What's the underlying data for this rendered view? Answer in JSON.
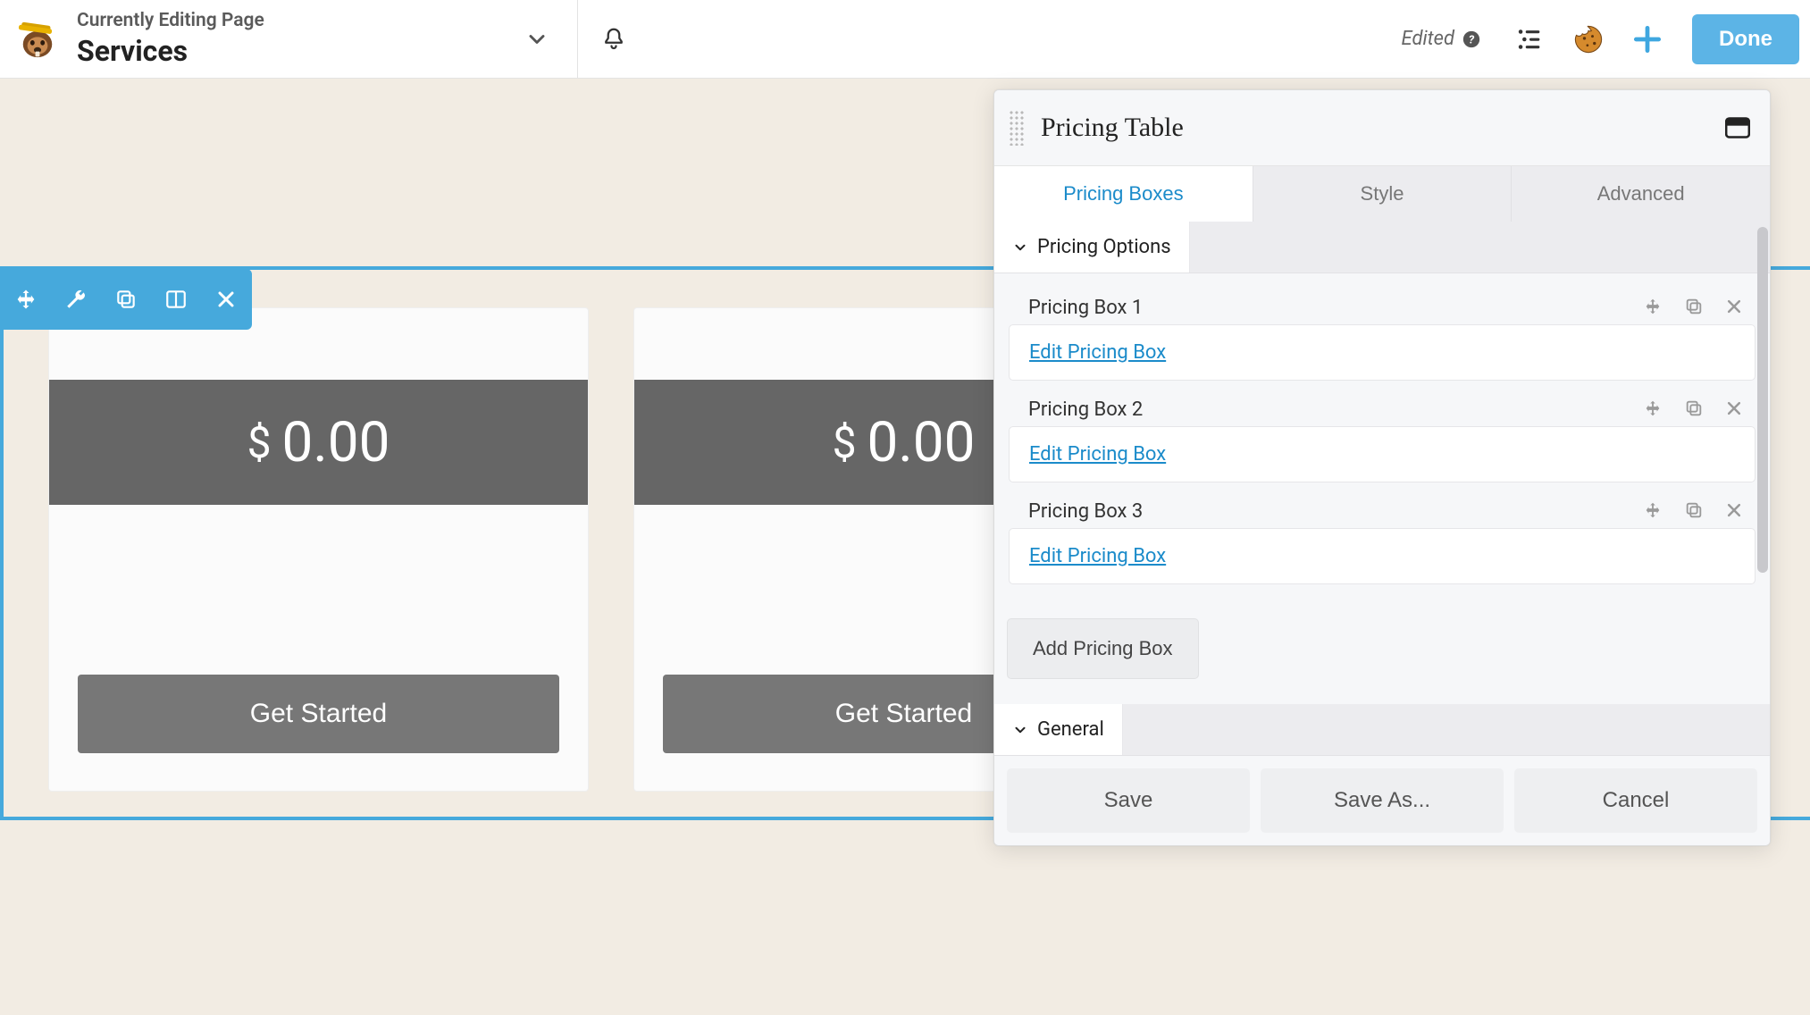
{
  "topbar": {
    "subtitle": "Currently Editing Page",
    "title": "Services",
    "edited_label": "Edited",
    "done_label": "Done"
  },
  "pricing_module": {
    "currency": "$",
    "cards": [
      {
        "price": "0.00",
        "cta": "Get Started"
      },
      {
        "price": "0.00",
        "cta": "Get Started"
      }
    ]
  },
  "panel": {
    "title": "Pricing Table",
    "tabs": [
      "Pricing Boxes",
      "Style",
      "Advanced"
    ],
    "active_tab": 0,
    "sections": {
      "pricing_options": {
        "label": "Pricing Options",
        "items": [
          {
            "name": "Pricing Box 1",
            "edit_label": "Edit Pricing Box"
          },
          {
            "name": "Pricing Box 2",
            "edit_label": "Edit Pricing Box"
          },
          {
            "name": "Pricing Box 3",
            "edit_label": "Edit Pricing Box"
          }
        ],
        "add_label": "Add Pricing Box"
      },
      "general": {
        "label": "General"
      }
    },
    "footer": {
      "save": "Save",
      "save_as": "Save As...",
      "cancel": "Cancel"
    }
  },
  "colors": {
    "accent": "#46a9dc",
    "done": "#5cb4e6",
    "link": "#1b8bca"
  }
}
